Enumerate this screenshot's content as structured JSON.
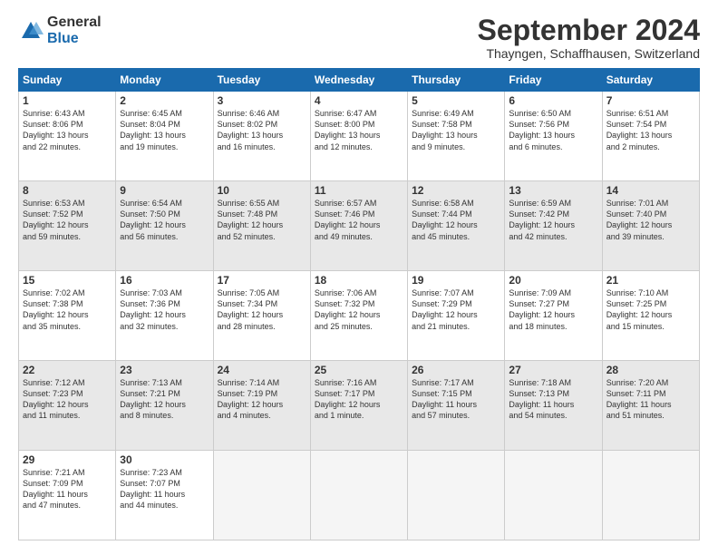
{
  "logo": {
    "general": "General",
    "blue": "Blue"
  },
  "title": "September 2024",
  "location": "Thayngen, Schaffhausen, Switzerland",
  "days_of_week": [
    "Sunday",
    "Monday",
    "Tuesday",
    "Wednesday",
    "Thursday",
    "Friday",
    "Saturday"
  ],
  "weeks": [
    [
      {
        "day": "1",
        "sunrise": "6:43 AM",
        "sunset": "8:06 PM",
        "daylight": "13 hours and 22 minutes."
      },
      {
        "day": "2",
        "sunrise": "6:45 AM",
        "sunset": "8:04 PM",
        "daylight": "13 hours and 19 minutes."
      },
      {
        "day": "3",
        "sunrise": "6:46 AM",
        "sunset": "8:02 PM",
        "daylight": "13 hours and 16 minutes."
      },
      {
        "day": "4",
        "sunrise": "6:47 AM",
        "sunset": "8:00 PM",
        "daylight": "13 hours and 12 minutes."
      },
      {
        "day": "5",
        "sunrise": "6:49 AM",
        "sunset": "7:58 PM",
        "daylight": "13 hours and 9 minutes."
      },
      {
        "day": "6",
        "sunrise": "6:50 AM",
        "sunset": "7:56 PM",
        "daylight": "13 hours and 6 minutes."
      },
      {
        "day": "7",
        "sunrise": "6:51 AM",
        "sunset": "7:54 PM",
        "daylight": "13 hours and 2 minutes."
      }
    ],
    [
      {
        "day": "8",
        "sunrise": "6:53 AM",
        "sunset": "7:52 PM",
        "daylight": "12 hours and 59 minutes."
      },
      {
        "day": "9",
        "sunrise": "6:54 AM",
        "sunset": "7:50 PM",
        "daylight": "12 hours and 56 minutes."
      },
      {
        "day": "10",
        "sunrise": "6:55 AM",
        "sunset": "7:48 PM",
        "daylight": "12 hours and 52 minutes."
      },
      {
        "day": "11",
        "sunrise": "6:57 AM",
        "sunset": "7:46 PM",
        "daylight": "12 hours and 49 minutes."
      },
      {
        "day": "12",
        "sunrise": "6:58 AM",
        "sunset": "7:44 PM",
        "daylight": "12 hours and 45 minutes."
      },
      {
        "day": "13",
        "sunrise": "6:59 AM",
        "sunset": "7:42 PM",
        "daylight": "12 hours and 42 minutes."
      },
      {
        "day": "14",
        "sunrise": "7:01 AM",
        "sunset": "7:40 PM",
        "daylight": "12 hours and 39 minutes."
      }
    ],
    [
      {
        "day": "15",
        "sunrise": "7:02 AM",
        "sunset": "7:38 PM",
        "daylight": "12 hours and 35 minutes."
      },
      {
        "day": "16",
        "sunrise": "7:03 AM",
        "sunset": "7:36 PM",
        "daylight": "12 hours and 32 minutes."
      },
      {
        "day": "17",
        "sunrise": "7:05 AM",
        "sunset": "7:34 PM",
        "daylight": "12 hours and 28 minutes."
      },
      {
        "day": "18",
        "sunrise": "7:06 AM",
        "sunset": "7:32 PM",
        "daylight": "12 hours and 25 minutes."
      },
      {
        "day": "19",
        "sunrise": "7:07 AM",
        "sunset": "7:29 PM",
        "daylight": "12 hours and 21 minutes."
      },
      {
        "day": "20",
        "sunrise": "7:09 AM",
        "sunset": "7:27 PM",
        "daylight": "12 hours and 18 minutes."
      },
      {
        "day": "21",
        "sunrise": "7:10 AM",
        "sunset": "7:25 PM",
        "daylight": "12 hours and 15 minutes."
      }
    ],
    [
      {
        "day": "22",
        "sunrise": "7:12 AM",
        "sunset": "7:23 PM",
        "daylight": "12 hours and 11 minutes."
      },
      {
        "day": "23",
        "sunrise": "7:13 AM",
        "sunset": "7:21 PM",
        "daylight": "12 hours and 8 minutes."
      },
      {
        "day": "24",
        "sunrise": "7:14 AM",
        "sunset": "7:19 PM",
        "daylight": "12 hours and 4 minutes."
      },
      {
        "day": "25",
        "sunrise": "7:16 AM",
        "sunset": "7:17 PM",
        "daylight": "12 hours and 1 minute."
      },
      {
        "day": "26",
        "sunrise": "7:17 AM",
        "sunset": "7:15 PM",
        "daylight": "11 hours and 57 minutes."
      },
      {
        "day": "27",
        "sunrise": "7:18 AM",
        "sunset": "7:13 PM",
        "daylight": "11 hours and 54 minutes."
      },
      {
        "day": "28",
        "sunrise": "7:20 AM",
        "sunset": "7:11 PM",
        "daylight": "11 hours and 51 minutes."
      }
    ],
    [
      {
        "day": "29",
        "sunrise": "7:21 AM",
        "sunset": "7:09 PM",
        "daylight": "11 hours and 47 minutes."
      },
      {
        "day": "30",
        "sunrise": "7:23 AM",
        "sunset": "7:07 PM",
        "daylight": "11 hours and 44 minutes."
      },
      null,
      null,
      null,
      null,
      null
    ]
  ]
}
